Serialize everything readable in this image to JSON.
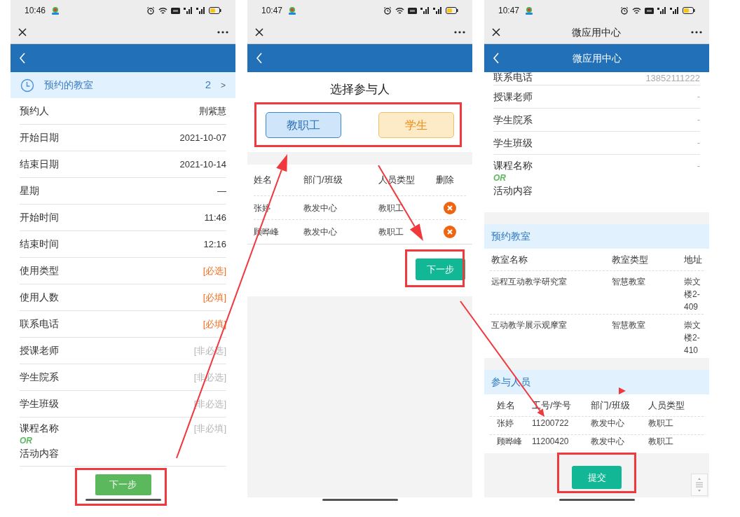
{
  "reservation_form": {
    "status_time": "10:46",
    "summary": {
      "label": "预约的教室",
      "count": "2",
      "chevron": ">"
    },
    "fields": [
      {
        "kind": "single",
        "label": "预约人",
        "value": "荆紫慧"
      },
      {
        "kind": "single",
        "label": "开始日期",
        "value": "2021-10-07"
      },
      {
        "kind": "single",
        "label": "结束日期",
        "value": "2021-10-14"
      },
      {
        "kind": "single",
        "label": "星期",
        "value": "—"
      },
      {
        "kind": "single",
        "label": "开始时间",
        "value": "11:46"
      },
      {
        "kind": "single",
        "label": "结束时间",
        "value": "12:16"
      },
      {
        "kind": "single",
        "label": "使用类型",
        "placeholder": "[必选]",
        "required": true
      },
      {
        "kind": "single",
        "label": "使用人数",
        "placeholder": "[必填]",
        "required": true
      },
      {
        "kind": "single",
        "label": "联系电话",
        "placeholder": "[必填]",
        "required": true
      },
      {
        "kind": "single",
        "label": "授课老师",
        "placeholder": "[非必选]",
        "required": false
      },
      {
        "kind": "single",
        "label": "学生院系",
        "placeholder": "[非必选]",
        "required": false
      },
      {
        "kind": "single",
        "label": "学生班级",
        "placeholder": "[非必选]",
        "required": false
      },
      {
        "kind": "either",
        "label": "课程名称",
        "connector": "OR",
        "alt_label": "活动内容",
        "placeholder": "[非必填]",
        "required": false
      }
    ],
    "next_button": "下一步"
  },
  "participant_picker": {
    "status_time": "10:47",
    "title": "选择参与人",
    "type_buttons": [
      {
        "kind": "staff",
        "label": "教职工"
      },
      {
        "kind": "student",
        "label": "学生"
      }
    ],
    "columns": [
      "姓名",
      "部门/班级",
      "人员类型",
      "删除"
    ],
    "rows": [
      {
        "name": "张婷",
        "department": "教发中心",
        "type": "教职工"
      },
      {
        "name": "顾晔峰",
        "department": "教发中心",
        "type": "教职工"
      }
    ],
    "next_button": "下一步"
  },
  "confirmation": {
    "status_time": "10:47",
    "window_title": "微应用中心",
    "header_title": "微应用中心",
    "fields": [
      {
        "kind": "single",
        "label": "联系电话",
        "value": "13852111222"
      },
      {
        "kind": "single",
        "label": "授课老师",
        "value": "-"
      },
      {
        "kind": "single",
        "label": "学生院系",
        "value": "-"
      },
      {
        "kind": "single",
        "label": "学生班级",
        "value": "-"
      },
      {
        "kind": "either",
        "label": "课程名称",
        "connector": "OR",
        "alt_label": "活动内容",
        "value": "-"
      }
    ],
    "classroom_section": {
      "title": "预约教室",
      "columns": [
        "教室名称",
        "教室类型",
        "地址"
      ],
      "rows": [
        [
          "远程互动教学研究室",
          "智慧教室",
          "崇文楼2-409"
        ],
        [
          "互动教学展示观摩室",
          "智慧教室",
          "崇文楼2-410"
        ]
      ]
    },
    "participant_section": {
      "title": "参与人员",
      "columns": [
        "姓名",
        "工号/学号",
        "部门/班级",
        "人员类型"
      ],
      "rows": [
        [
          "张婷",
          "11200722",
          "教发中心",
          "教职工"
        ],
        [
          "顾晔峰",
          "11200420",
          "教发中心",
          "教职工"
        ]
      ]
    },
    "submit_button": "提交"
  }
}
